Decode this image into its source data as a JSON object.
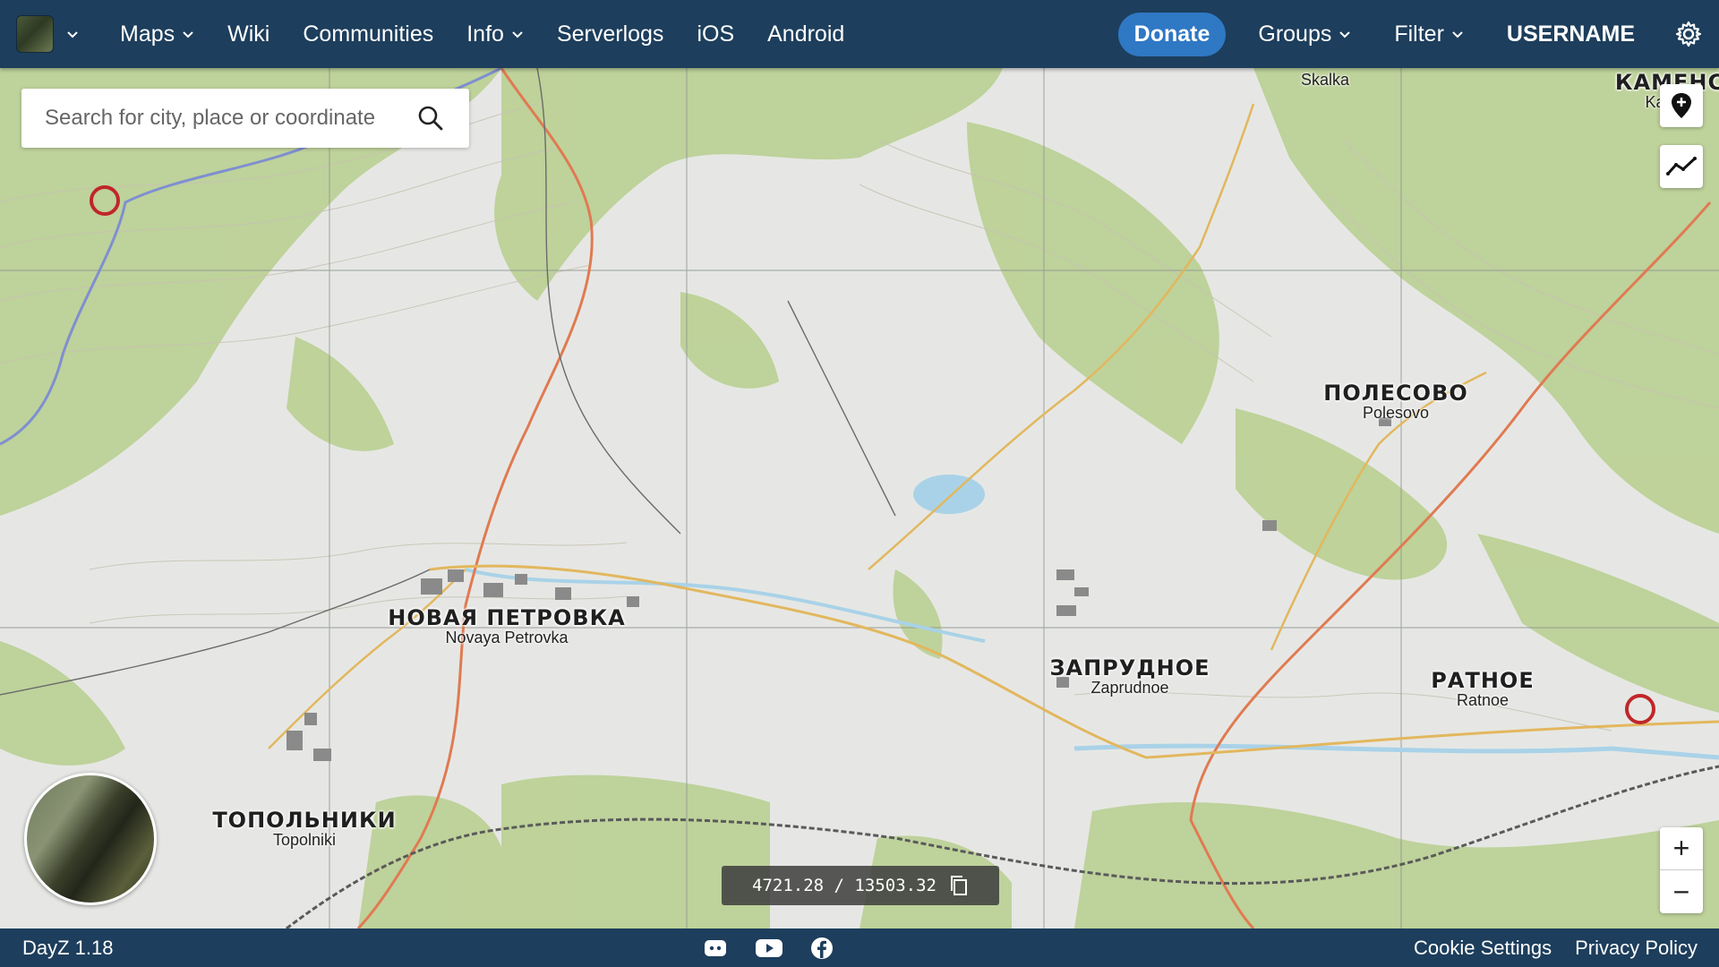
{
  "nav": {
    "items": [
      {
        "label": "Maps",
        "dropdown": true
      },
      {
        "label": "Wiki",
        "dropdown": false
      },
      {
        "label": "Communities",
        "dropdown": false
      },
      {
        "label": "Info",
        "dropdown": true
      },
      {
        "label": "Serverlogs",
        "dropdown": false
      },
      {
        "label": "iOS",
        "dropdown": false
      },
      {
        "label": "Android",
        "dropdown": false
      }
    ],
    "donate": "Donate",
    "groups": "Groups",
    "filter": "Filter",
    "username": "USERNAME"
  },
  "search": {
    "placeholder": "Search for city, place or coordinate"
  },
  "map": {
    "cities": [
      {
        "ru": "НОВАЯ ПЕТРОВКА",
        "en": "Novaya Petrovka"
      },
      {
        "ru": "ЗАПРУДНОЕ",
        "en": "Zaprudnoe"
      },
      {
        "ru": "ПОЛЕСОВО",
        "en": "Polesovo"
      },
      {
        "ru": "РАТНОЕ",
        "en": "Ratnoe"
      },
      {
        "ru": "ТОПОЛЬНИКИ",
        "en": "Topolniki"
      },
      {
        "ru": "КАМЕНС",
        "en": "Ka...sk"
      }
    ],
    "places": [
      "Skalka"
    ],
    "coordinates": "4721.28 / 13503.32",
    "colors": {
      "forest": "#b9cf94",
      "road_main": "#e07a52",
      "road_secondary": "#e2b75e",
      "water": "#a9d2e8",
      "grid": "#9aa09a"
    }
  },
  "footer": {
    "version": "DayZ 1.18",
    "cookie": "Cookie Settings",
    "privacy": "Privacy Policy"
  }
}
